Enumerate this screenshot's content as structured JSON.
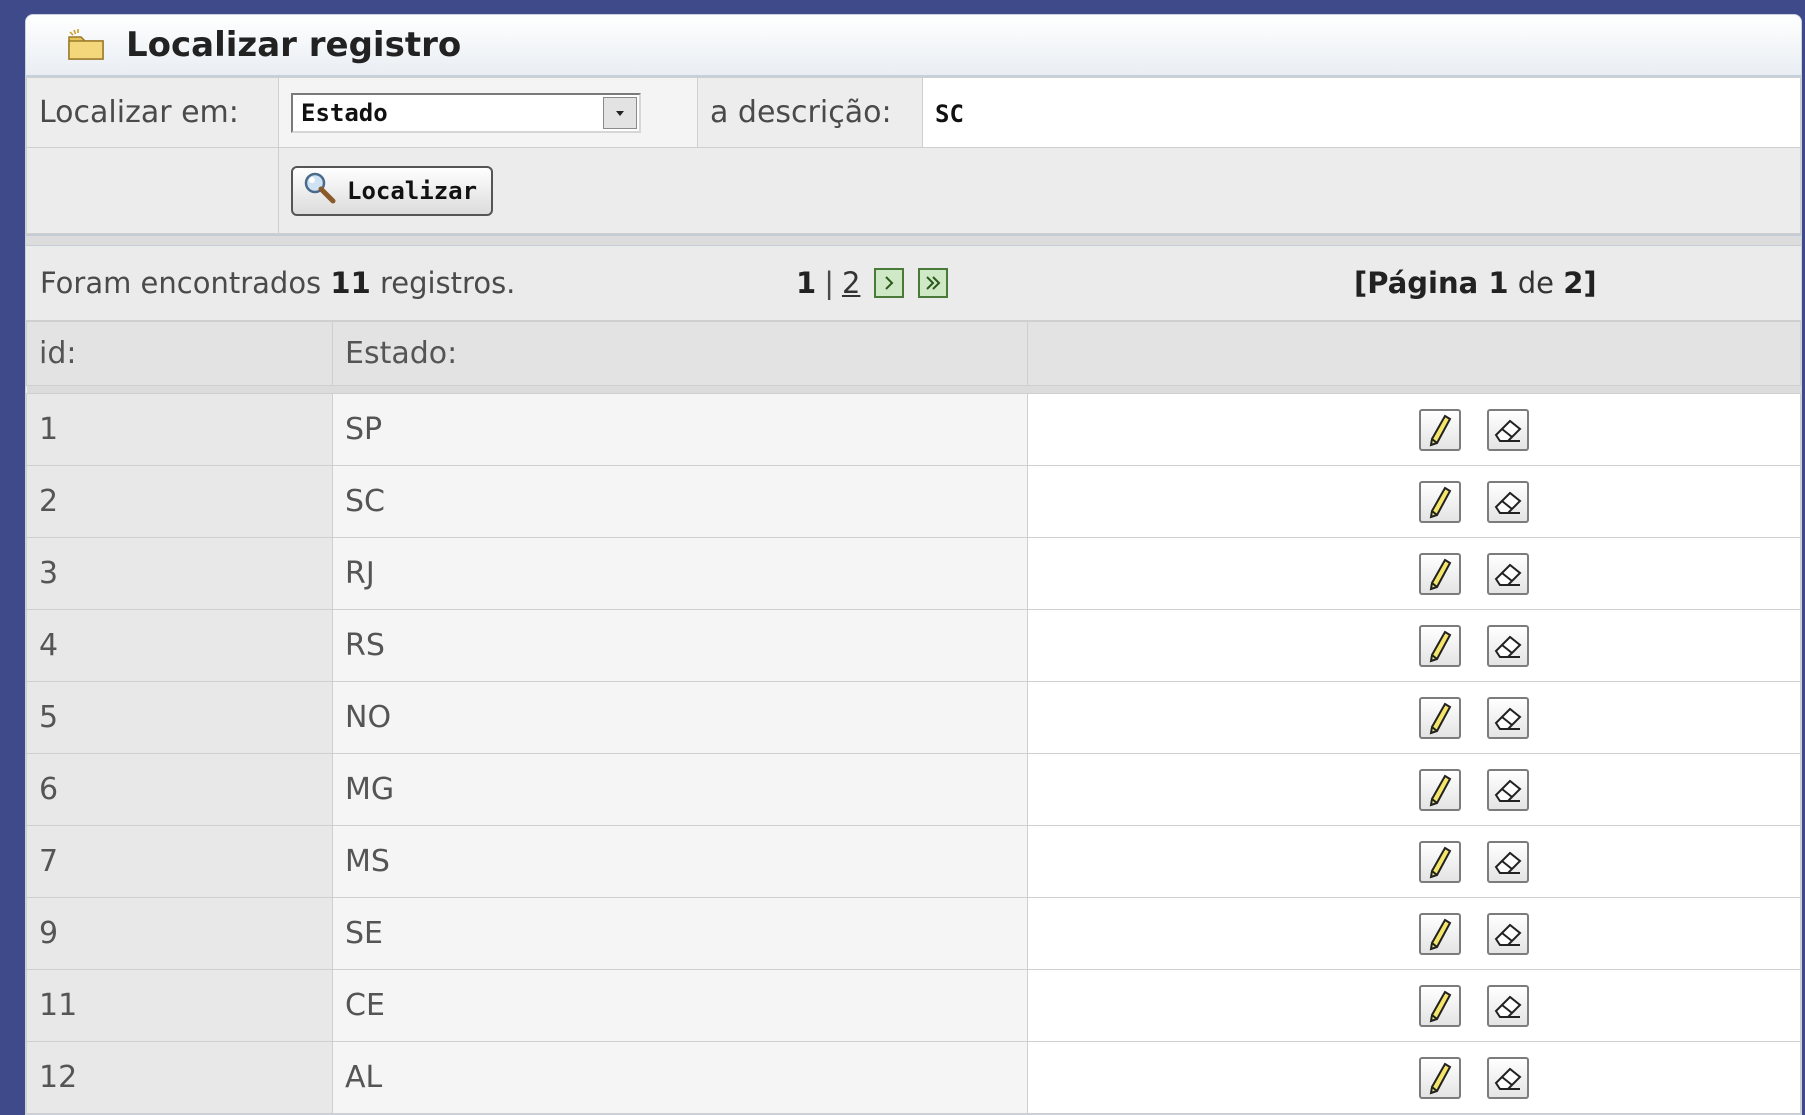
{
  "title": "Localizar registro",
  "search": {
    "field_label": "Localizar em:",
    "field_selected": "Estado",
    "desc_label": "a descrição:",
    "desc_value": "SC",
    "button_label": "Localizar"
  },
  "results": {
    "count_prefix": "Foram encontrados ",
    "count": "11",
    "count_suffix": " registros.",
    "pager_current": "1",
    "pager_sep": "|",
    "pager_next_page": "2",
    "page_info_open": "[Página ",
    "page_current": "1",
    "page_of": " de ",
    "page_total": "2",
    "page_info_close": "]"
  },
  "table": {
    "headers": [
      "id:",
      "Estado:",
      ""
    ],
    "rows": [
      {
        "id": "1",
        "estado": "SP"
      },
      {
        "id": "2",
        "estado": "SC"
      },
      {
        "id": "3",
        "estado": "RJ"
      },
      {
        "id": "4",
        "estado": "RS"
      },
      {
        "id": "5",
        "estado": "NO"
      },
      {
        "id": "6",
        "estado": "MG"
      },
      {
        "id": "7",
        "estado": "MS"
      },
      {
        "id": "9",
        "estado": "SE"
      },
      {
        "id": "11",
        "estado": "CE"
      },
      {
        "id": "12",
        "estado": "AL"
      }
    ]
  },
  "icons": {
    "title": "folder-icon",
    "select_arrow": "chevron-down-icon",
    "search_button": "magnifier-icon",
    "next": "next-page-icon",
    "last": "last-page-icon",
    "edit": "pencil-icon",
    "delete": "eraser-icon"
  },
  "colors": {
    "background": "#3f4a8a",
    "panel": "#f2f2f2",
    "border": "#cfcfcf",
    "nav_button": "#cfe8c5"
  }
}
